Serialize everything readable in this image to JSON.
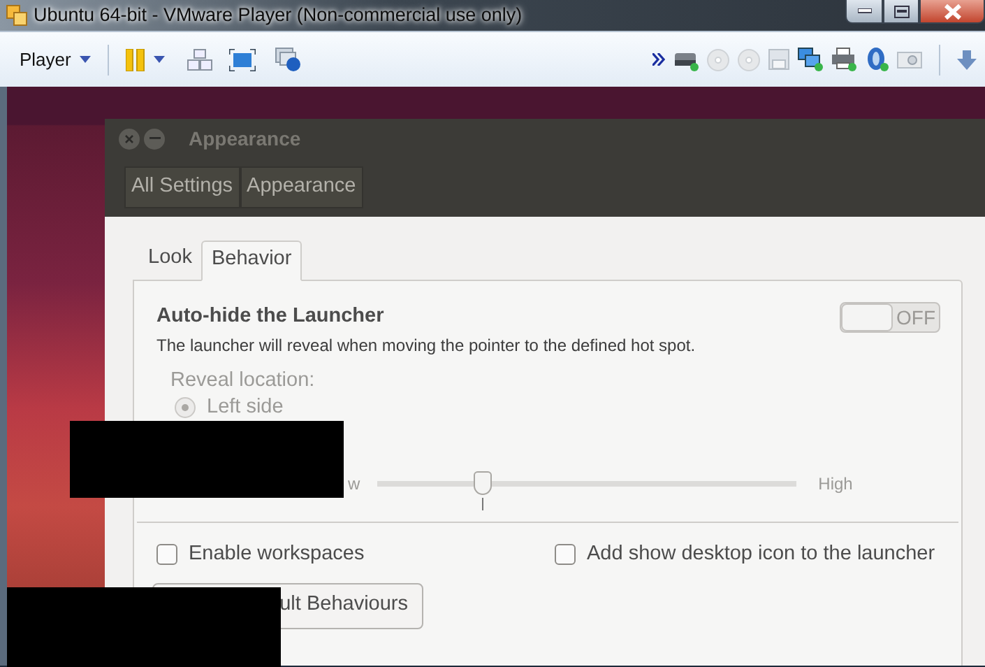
{
  "window": {
    "title": "Ubuntu 64-bit - VMware Player (Non-commercial use only)"
  },
  "toolbar": {
    "menu": "Player"
  },
  "appearance_window": {
    "title": "Appearance",
    "breadcrumbs": [
      "All Settings",
      "Appearance"
    ],
    "tabs": [
      {
        "label": "Look",
        "selected": false
      },
      {
        "label": "Behavior",
        "selected": true
      }
    ],
    "autohide": {
      "title": "Auto-hide the Launcher",
      "description": "The launcher will reveal when moving the pointer to the defined hot spot.",
      "toggle": {
        "label": "OFF",
        "on": false
      }
    },
    "reveal": {
      "label": "Reveal location:",
      "disabled": true,
      "options": [
        {
          "label": "Left side",
          "selected": true
        }
      ]
    },
    "sensitivity": {
      "low_label": "w",
      "high_label": "High",
      "level": 0.25
    },
    "checkboxes": [
      {
        "label": "Enable workspaces",
        "checked": false
      },
      {
        "label": "Add show desktop icon to the launcher",
        "checked": false
      }
    ],
    "reset_button": "ult Behaviours"
  }
}
